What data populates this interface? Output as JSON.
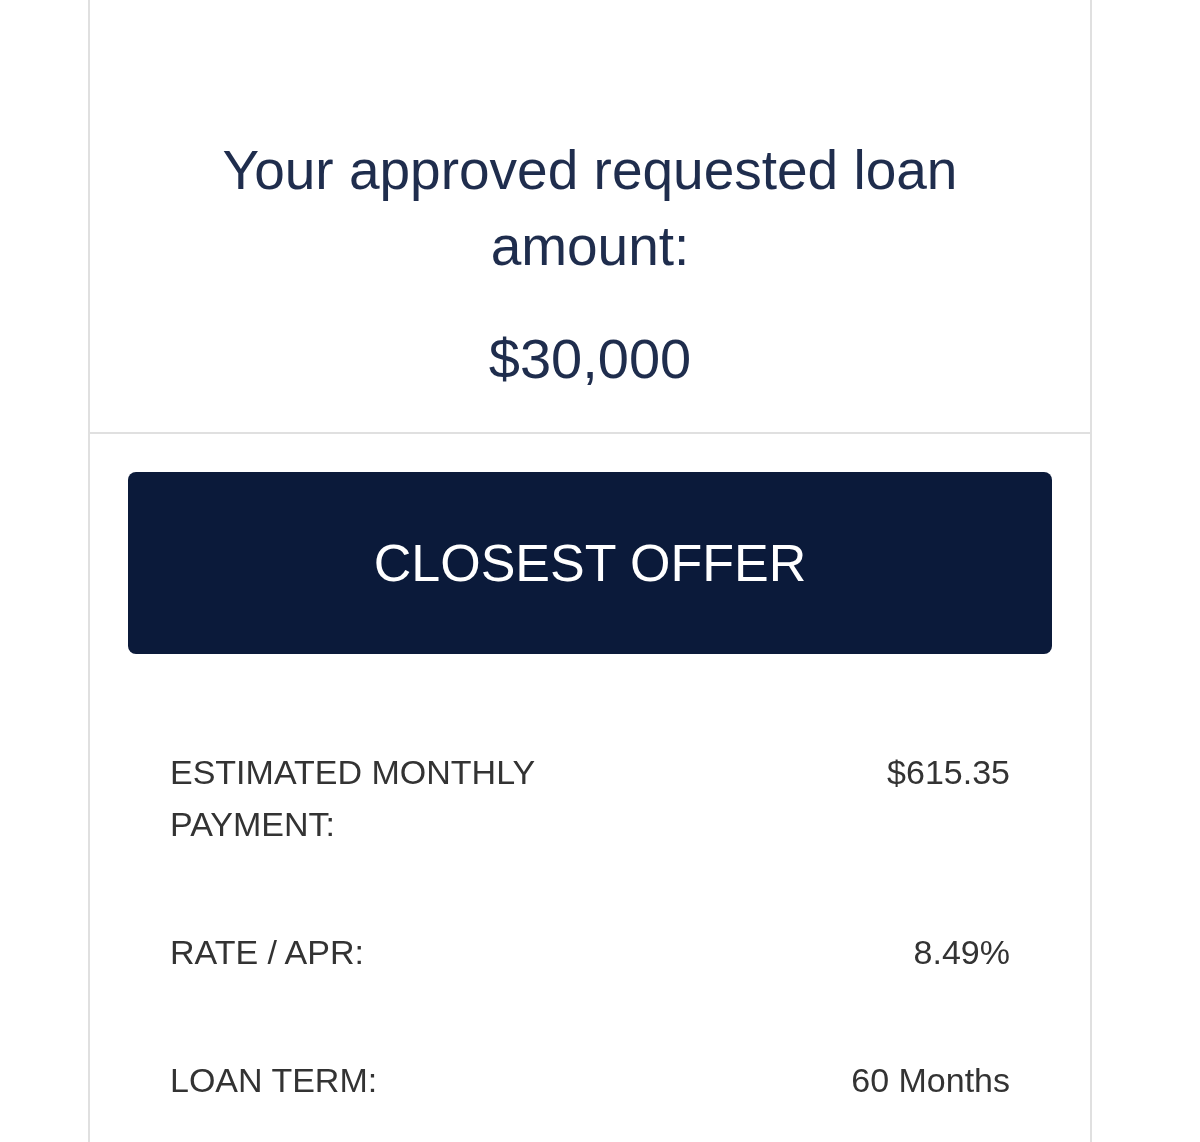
{
  "heading": "Your approved requested loan amount:",
  "amount": "$30,000",
  "offer_button": "CLOSEST OFFER",
  "details": [
    {
      "label": "ESTIMATED MONTHLY PAYMENT:",
      "value": "$615.35"
    },
    {
      "label": "RATE / APR:",
      "value": "8.49%"
    },
    {
      "label": "LOAN TERM:",
      "value": "60 Months"
    }
  ]
}
